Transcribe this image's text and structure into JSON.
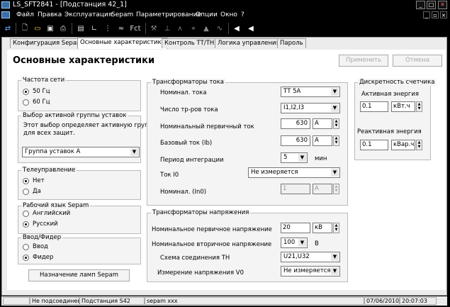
{
  "window": {
    "title": "LS_SFT2841 - [Подстанция 42_1]"
  },
  "menu": [
    "Файл",
    "Правка",
    "Эксплуатация",
    "Sepam",
    "Параметрирование",
    "Опции",
    "Окно",
    "?"
  ],
  "toolbar": {
    "fct_label": "Fct"
  },
  "tabs": [
    {
      "label": "Конфигурация Sepam",
      "active": false
    },
    {
      "label": "Основные характеристики",
      "active": true
    },
    {
      "label": "Контроль ТТ/ТН",
      "active": false
    },
    {
      "label": "Логика управления",
      "active": false
    },
    {
      "label": "Пароль",
      "active": false
    }
  ],
  "page": {
    "title": "Основные характеристики",
    "apply_label": "Применить",
    "cancel_label": "Отмена"
  },
  "freq": {
    "title": "Частота сети",
    "opt1": "50 Гц",
    "opt2": "60 Гц",
    "selected": 1
  },
  "group_sel": {
    "title": "Выбор активной группы уставок",
    "desc1": "Этот выбор определяет активную группу",
    "desc2": "для всех защит.",
    "value": "Группа уставок А"
  },
  "remote": {
    "title": "Телеуправление",
    "opt1": "Нет",
    "opt2": "Да",
    "selected": 1
  },
  "lang": {
    "title": "Рабочий язык Sepam",
    "opt1": "Английский",
    "opt2": "Русский",
    "selected": 2
  },
  "feeder": {
    "title": "Ввод/Фидер",
    "opt1": "Ввод",
    "opt2": "Фидер",
    "selected": 2
  },
  "lamps_button": "Назначение ламп Sepam",
  "ct": {
    "title": "Трансформаторы тока",
    "nominal_label": "Номинал. тока",
    "nominal_value": "ТТ 5А",
    "count_label": "Число тр-ров тока",
    "count_value": "I1,I2,I3",
    "primary_label": "Номинальный первичный ток",
    "primary_value": "630",
    "primary_unit": "А",
    "base_label": "Базовый ток (Ib)",
    "base_value": "630",
    "base_unit": "А",
    "period_label": "Период интеграции",
    "period_value": "5",
    "period_unit": "мин",
    "i0_label": "Ток I0",
    "i0_value": "Не измеряется",
    "in0_label": "Номинал. (In0)",
    "in0_value": "1",
    "in0_unit": "А"
  },
  "vt": {
    "title": "Трансформаторы напряжения",
    "primary_label": "Номинальное первичное напряжение",
    "primary_value": "20",
    "primary_unit": "кВ",
    "secondary_label": "Номинальное вторичное напряжение",
    "secondary_value": "100",
    "secondary_unit": "В",
    "scheme_label": "Схема соединения ТН",
    "scheme_value": "U21,U32",
    "v0_label": "Измерение напряжения V0",
    "v0_value": "Не измеряется"
  },
  "counter": {
    "title": "Дискретность счетчика",
    "active_label": "Активная энергия",
    "active_value": "0.1",
    "active_unit": "кВт.ч",
    "reactive_label": "Реактивная энергия",
    "reactive_value": "0.1",
    "reactive_unit": "кВар.ч"
  },
  "status": {
    "connection": "Не подсоединен",
    "substation": "Подстанция S42",
    "sepam": "sepam xxx",
    "date": "07/06/2010",
    "time": "20:07:03"
  }
}
